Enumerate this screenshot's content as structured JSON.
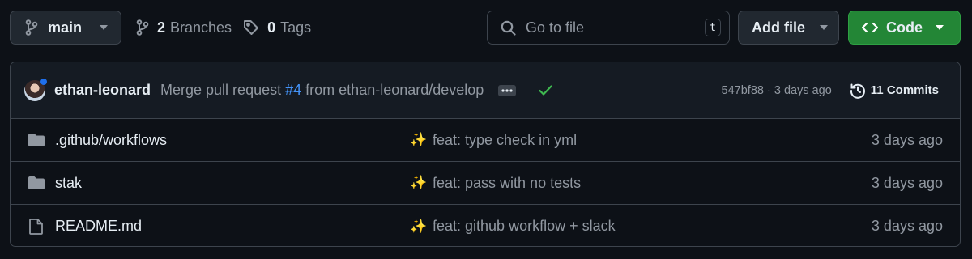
{
  "toolbar": {
    "branch": "main",
    "branches_count": "2",
    "branches_label": "Branches",
    "tags_count": "0",
    "tags_label": "Tags",
    "search_placeholder": "Go to file",
    "search_shortcut": "t",
    "add_file_label": "Add file",
    "code_label": "Code"
  },
  "latest_commit": {
    "author": "ethan-leonard",
    "message_prefix": "Merge pull request",
    "pr_link": "#4",
    "message_suffix": "from ethan-leonard/develop",
    "status": "success",
    "sha_age": "547bf88 · 3 days ago",
    "commits_label": "11 Commits"
  },
  "files": [
    {
      "type": "folder",
      "name": ".github/workflows",
      "emoji": "✨",
      "message": "feat: type check in yml",
      "age": "3 days ago"
    },
    {
      "type": "folder",
      "name": "stak",
      "emoji": "✨",
      "message": "feat: pass with no tests",
      "age": "3 days ago"
    },
    {
      "type": "file",
      "name": "README.md",
      "emoji": "✨",
      "message": "feat: github workflow + slack",
      "age": "3 days ago"
    }
  ],
  "colors": {
    "background": "#0d1117",
    "border": "#3d444d",
    "muted": "#9198a1",
    "link": "#4493f8",
    "success": "#3fb950",
    "primary_button": "#238636"
  }
}
